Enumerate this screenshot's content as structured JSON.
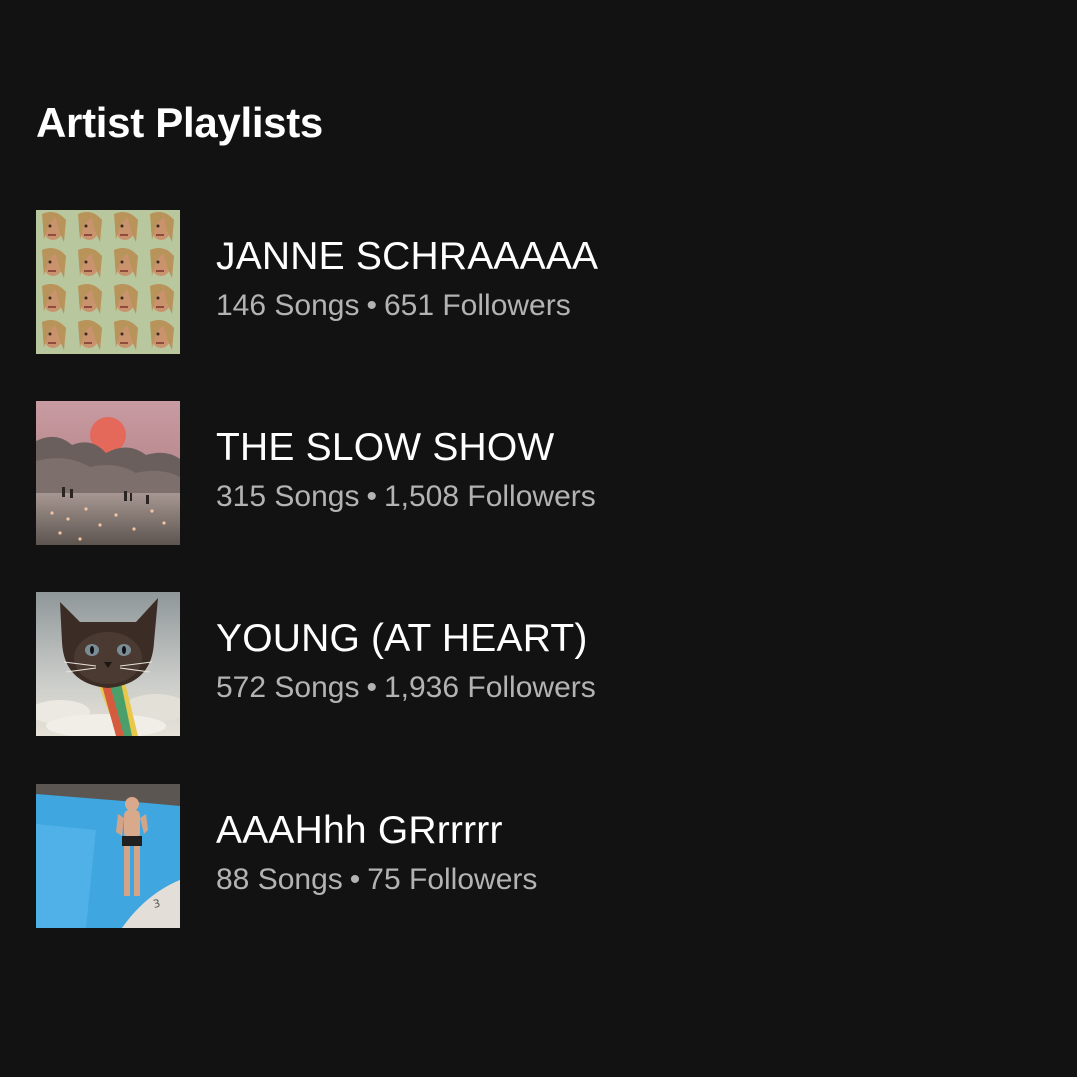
{
  "section": {
    "title": "Artist Playlists"
  },
  "separator": "•",
  "playlists": [
    {
      "name": "JANNE SCHRAAAAA",
      "songs": "146 Songs",
      "followers": "651 Followers",
      "cover_icon": "portrait-collage-cover"
    },
    {
      "name": "THE SLOW SHOW",
      "songs": "315 Songs",
      "followers": "1,508 Followers",
      "cover_icon": "sunset-lake-cover"
    },
    {
      "name": "YOUNG (AT HEART)",
      "songs": "572 Songs",
      "followers": "1,936 Followers",
      "cover_icon": "cat-rainbow-cover"
    },
    {
      "name": "AAAHhh GRrrrrr",
      "songs": "88 Songs",
      "followers": "75 Followers",
      "cover_icon": "swimming-pool-cover"
    }
  ],
  "colors": {
    "background": "#121212",
    "primary_text": "#ffffff",
    "secondary_text": "#b3b3b3"
  }
}
